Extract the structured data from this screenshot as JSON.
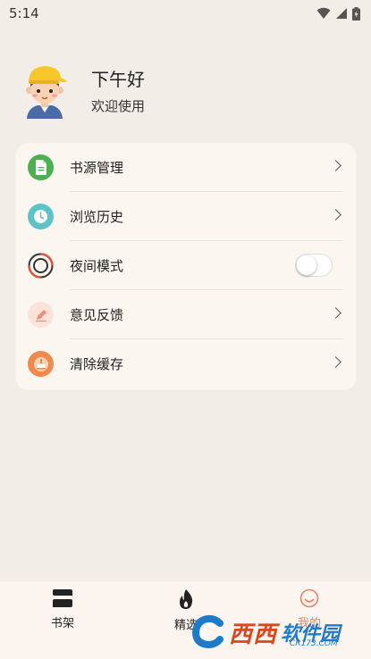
{
  "status_bar": {
    "time": "5:14",
    "icons": [
      "wifi-icon",
      "signal-icon",
      "battery-icon"
    ]
  },
  "profile": {
    "greeting": "下午好",
    "subtitle": "欢迎使用"
  },
  "menu": {
    "items": [
      {
        "label": "书源管理",
        "icon": "document-icon",
        "icon_color": "#4caf50",
        "control": "chevron"
      },
      {
        "label": "浏览历史",
        "icon": "clock-icon",
        "icon_color": "#5bc4c8",
        "control": "chevron"
      },
      {
        "label": "夜间模式",
        "icon": "night-mode-icon",
        "icon_color": "#e5533d",
        "control": "toggle",
        "toggle_on": false
      },
      {
        "label": "意见反馈",
        "icon": "feedback-icon",
        "icon_color": "#f08c78",
        "control": "chevron"
      },
      {
        "label": "清除缓存",
        "icon": "broom-icon",
        "icon_color": "#f0894a",
        "control": "chevron"
      }
    ]
  },
  "bottom_nav": {
    "tabs": [
      {
        "label": "书架",
        "icon": "bookshelf-icon",
        "active": false
      },
      {
        "label": "精选",
        "icon": "flame-icon",
        "active": false
      },
      {
        "label": "我的",
        "icon": "smile-icon",
        "active": true
      }
    ],
    "active_color": "#e8836b"
  },
  "watermark": {
    "site": "西西",
    "name": "软件园",
    "url": "CR173.COM"
  }
}
